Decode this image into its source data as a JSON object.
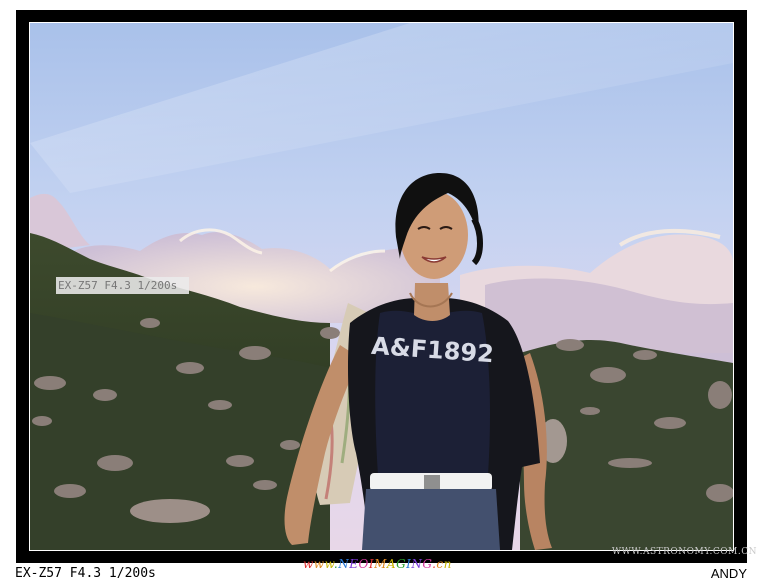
{
  "photo": {
    "exif_overlay": "EX-Z57 F4.3 1/200s",
    "shirt_text": "A&F1892"
  },
  "captions": {
    "camera_info": "EX-Z57 F4.3 1/200s",
    "site_watermark": "www.NEOIMAGING.cn",
    "photographer": "ANDY",
    "corner_watermark": "WWW.ASTRONOMY.COM.CN"
  }
}
